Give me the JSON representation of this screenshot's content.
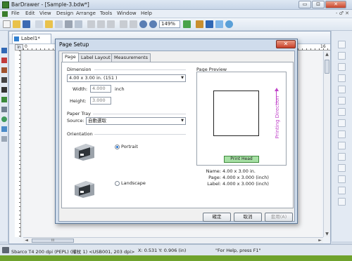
{
  "window": {
    "title": "BarDrawer - [Sample-3.bdw*]",
    "minimize": "▭",
    "maximize": "⊡",
    "close": "✕"
  },
  "menu": [
    "File",
    "Edit",
    "View",
    "Design",
    "Arrange",
    "Tools",
    "Window",
    "Help"
  ],
  "mdi": {
    "controls": "- ♂ ✕"
  },
  "toolbar": {
    "zoom": "149%"
  },
  "document": {
    "tab_label": "Label1*",
    "ruler_unit": "in",
    "ruler_zero": "0",
    "ruler_end": "16"
  },
  "scroll": {
    "up": "▲",
    "down": "▼",
    "left": "◄",
    "right": "►",
    "grip": "III"
  },
  "dialog": {
    "title": "Page Setup",
    "close": "✕",
    "tabs": [
      "Page",
      "Label Layout",
      "Measurements"
    ],
    "dimension": {
      "label": "Dimension",
      "selected": "4.00 x 3.00 in. (151 )",
      "width_label": "Width:",
      "width_value": "4.000",
      "height_label": "Height:",
      "height_value": "3.000",
      "unit": "inch"
    },
    "paper_tray": {
      "label": "Paper Tray",
      "source_label": "Source:",
      "source_value": "自動選取"
    },
    "orientation": {
      "label": "Orientation",
      "portrait": "Portrait",
      "landscape": "Landscape",
      "selected": "portrait"
    },
    "preview": {
      "label": "Page Preview",
      "print_head": "Print Head",
      "direction": "Printing Direction",
      "name_label": "Name:",
      "name_value": "4.00 x 3.00 in.",
      "page_label": "Page:",
      "page_value": "4.000 x 3.000 (inch)",
      "label_label": "Label:",
      "label_value": "4.000 x 3.000 (inch)"
    },
    "buttons": {
      "ok": "確定",
      "cancel": "取消",
      "apply": "套用(A)"
    }
  },
  "status": {
    "printer": "Sbarco T4 200 dpi (PEPL) (權杖 1) <USB001, 203 dpi>",
    "coords": "X: 0.531  Y: 0.906 (in)",
    "help": "\"For Help, press F1\""
  }
}
